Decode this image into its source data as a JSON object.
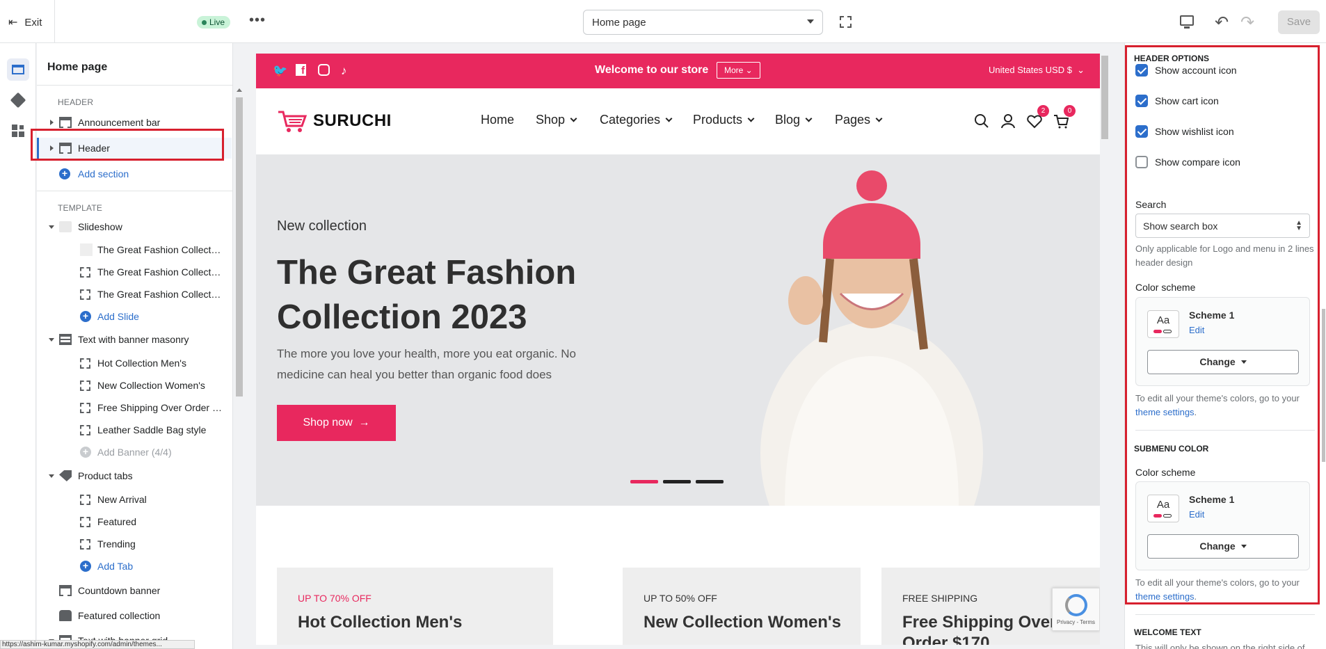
{
  "topbar": {
    "exit_label": "Exit",
    "live_label": "Live",
    "page_select_value": "Home page",
    "save_label": "Save"
  },
  "sidebar": {
    "title": "Home page",
    "header_section_label": "HEADER",
    "template_section_label": "TEMPLATE",
    "announcement_bar": "Announcement bar",
    "header": "Header",
    "add_section": "Add section",
    "slideshow": "Slideshow",
    "slides": [
      "The Great Fashion Collectio...",
      "The Great Fashion Collectio...",
      "The Great Fashion Collectio..."
    ],
    "add_slide": "Add Slide",
    "text_with_banner_masonry": "Text with banner masonry",
    "banners": [
      "Hot Collection Men's",
      "New Collection Women's",
      "Free Shipping Over Order $...",
      "Leather Saddle Bag style"
    ],
    "add_banner": "Add Banner (4/4)",
    "product_tabs": "Product tabs",
    "tabs": [
      "New Arrival",
      "Featured",
      "Trending"
    ],
    "add_tab": "Add Tab",
    "countdown_banner": "Countdown banner",
    "featured_collection": "Featured collection",
    "text_with_banner_grid": "Text with banner grid"
  },
  "status_url": "https://ashim-kumar.myshopify.com/admin/themes...",
  "preview": {
    "announcement": {
      "social": [
        "twitter",
        "facebook",
        "instagram",
        "tiktok"
      ],
      "text": "Welcome to our store",
      "more_label": "More",
      "currency": "United States USD $"
    },
    "logo_text": "SURUCHI",
    "nav": [
      "Home",
      "Shop",
      "Categories",
      "Products",
      "Blog",
      "Pages"
    ],
    "wishlist_count": "2",
    "cart_count": "0",
    "hero": {
      "eyebrow": "New collection",
      "title": "The Great Fashion Collection 2023",
      "description": "The more you love your health, more you eat organic. No medicine can heal you better than organic food does",
      "button_label": "Shop now",
      "slide_count": 3,
      "active_slide": 1
    },
    "promos": [
      {
        "eyebrow": "UP TO 70% OFF",
        "title": "Hot Collection Men's",
        "eyebrow_color": "#e8285e"
      },
      {
        "eyebrow": "UP TO 50% OFF",
        "title": "New Collection Women's",
        "eyebrow_color": "#333333"
      },
      {
        "eyebrow": "FREE SHIPPING",
        "title": "Free Shipping Over Order $170",
        "eyebrow_color": "#333333"
      }
    ],
    "recaptcha_text": "Privacy - Terms"
  },
  "panel": {
    "header_options_heading": "HEADER OPTIONS",
    "show_account_icon": {
      "label": "Show account icon",
      "checked": true
    },
    "show_cart_icon": {
      "label": "Show cart icon",
      "checked": true
    },
    "show_wishlist_icon": {
      "label": "Show wishlist icon",
      "checked": true
    },
    "show_compare_icon": {
      "label": "Show compare icon",
      "checked": false
    },
    "search_label": "Search",
    "search_value": "Show search box",
    "search_help": "Only applicable for Logo and menu in 2 lines header design",
    "color_scheme_label": "Color scheme",
    "scheme_swatch_text": "Aa",
    "scheme_name": "Scheme 1",
    "edit_label": "Edit",
    "change_label": "Change",
    "colors_help_prefix": "To edit all your theme's colors, go to your",
    "theme_settings_link": "theme settings",
    "submenu_heading": "SUBMENU COLOR",
    "welcome_heading": "WELCOME TEXT",
    "welcome_help": "This will only be shown on the right side of..."
  },
  "colors": {
    "accent": "#e8285e",
    "link": "#2c6ecb",
    "highlight_border": "#d7202e"
  }
}
